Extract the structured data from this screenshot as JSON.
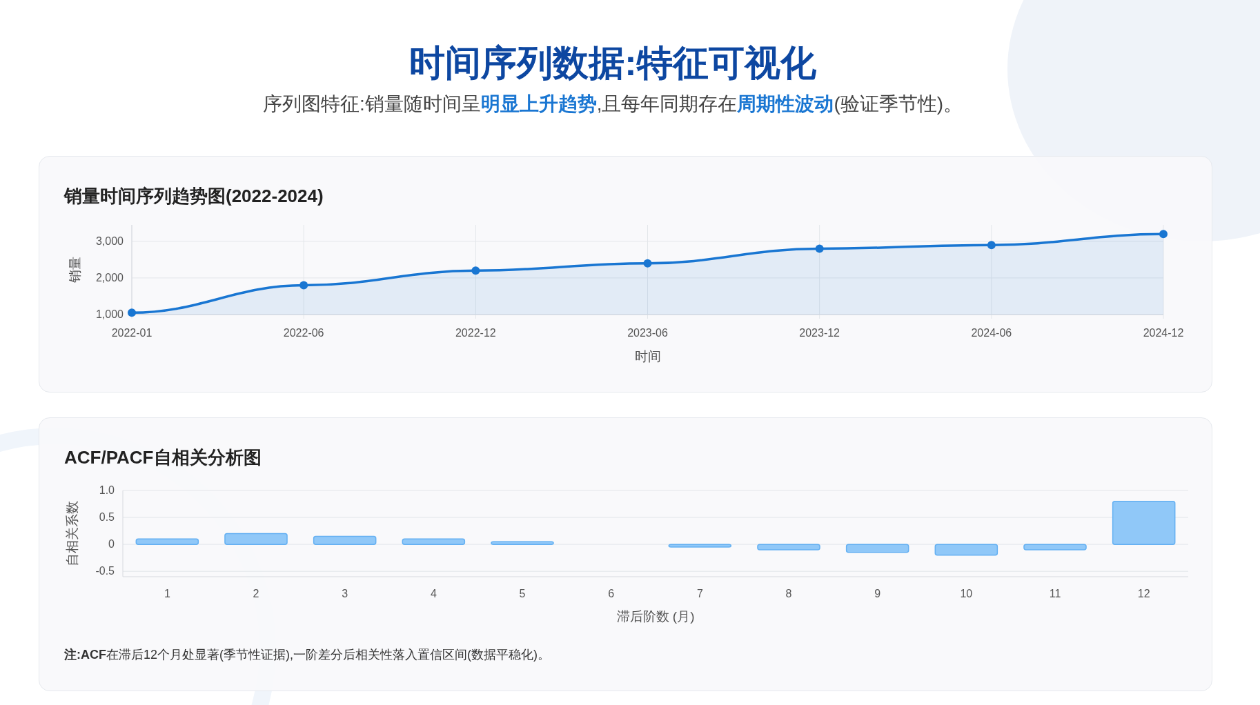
{
  "header": {
    "title": "时间序列数据:特征可视化",
    "subtitle": "序列图特征:销量随时间呈**明显上升趋势**,且每年同期存在**周期性波动**(验证季节性)。"
  },
  "panels": [
    {
      "chart_data": {
        "type": "area",
        "title": "销量时间序列趋势图(2022-2024)",
        "xlabel": "时间",
        "ylabel": "销量",
        "categories": [
          "2022-01",
          "2022-06",
          "2022-12",
          "2023-06",
          "2023-12",
          "2024-06",
          "2024-12"
        ],
        "grid": true,
        "series": [
          {
            "color": "#1976d2",
            "values": [
              1050,
              1800,
              2200,
              2400,
              2800,
              2900,
              3200
            ]
          }
        ],
        "ylim": [
          1000,
          3450
        ],
        "yticks": [
          {
            "value": 1000,
            "label": "1,000"
          },
          {
            "value": 2000,
            "label": "2,000"
          },
          {
            "value": 3000,
            "label": "3,000"
          }
        ]
      }
    },
    {
      "chart_data": {
        "type": "bar",
        "title": "ACF/PACF自相关分析图",
        "xlabel": "滞后阶数 (月)",
        "ylabel": "自相关系数",
        "categories": [
          "1",
          "2",
          "3",
          "4",
          "5",
          "6",
          "7",
          "8",
          "9",
          "10",
          "11",
          "12"
        ],
        "grid": true,
        "series": [
          {
            "color": "#90c8f8",
            "values": [
              0.1,
              0.2,
              0.15,
              0.1,
              0.05,
              0,
              -0.05,
              -0.1,
              -0.15,
              -0.2,
              -0.1,
              0.8
            ]
          }
        ],
        "ylim": [
          -0.6,
          1.0
        ],
        "yticks": [
          {
            "value": -0.5,
            "label": "-0.5"
          },
          {
            "value": 0,
            "label": "0"
          },
          {
            "value": 0.5,
            "label": "0.5"
          },
          {
            "value": 1.0,
            "label": "1.0"
          }
        ]
      },
      "note": "**注:ACF**在滞后12个月处显著(季节性证据),一阶差分后相关性落入置信区间(数据平稳化)。"
    }
  ]
}
